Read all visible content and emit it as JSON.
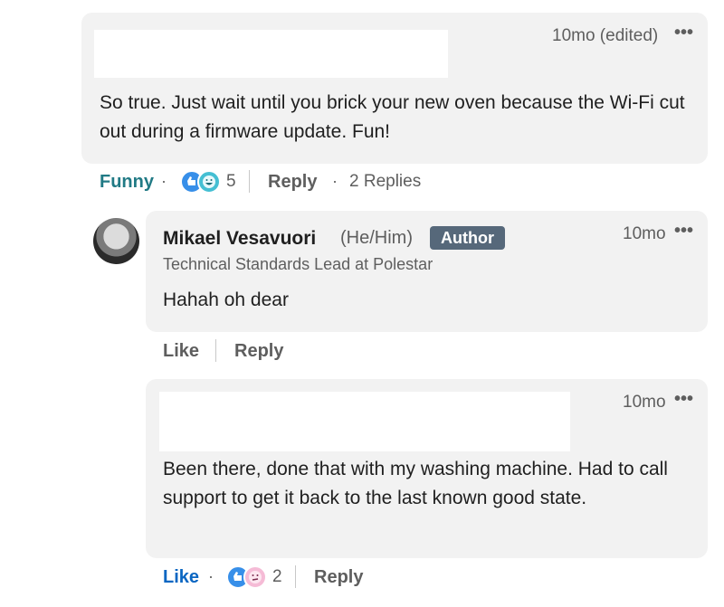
{
  "comments": [
    {
      "time": "10mo (edited)",
      "text": "So true. Just wait until you brick your new oven because the Wi-Fi cut out during a firmware update. Fun!",
      "reaction_label": "Funny",
      "reaction_count": "5",
      "reply_label": "Reply",
      "replies_label": "2 Replies"
    },
    {
      "author": "Mikael Vesavuori",
      "pronouns": "(He/Him)",
      "badge": "Author",
      "headline": "Technical Standards Lead at Polestar",
      "time": "10mo",
      "text": "Hahah oh dear",
      "like_label": "Like",
      "reply_label": "Reply"
    },
    {
      "time": "10mo",
      "text": "Been there, done that with my washing machine. Had to call support to get it back to the last known good state.",
      "like_label": "Like",
      "reaction_count": "2",
      "reply_label": "Reply"
    }
  ],
  "icons": {
    "more": "ellipsis-icon",
    "like_reaction": "thumbs-up-icon",
    "funny_reaction": "laughing-face-icon",
    "curious_reaction": "thinking-face-icon"
  },
  "colors": {
    "funny": "#217a85",
    "like_active": "#0a66c2",
    "badge_bg": "#56687a"
  }
}
